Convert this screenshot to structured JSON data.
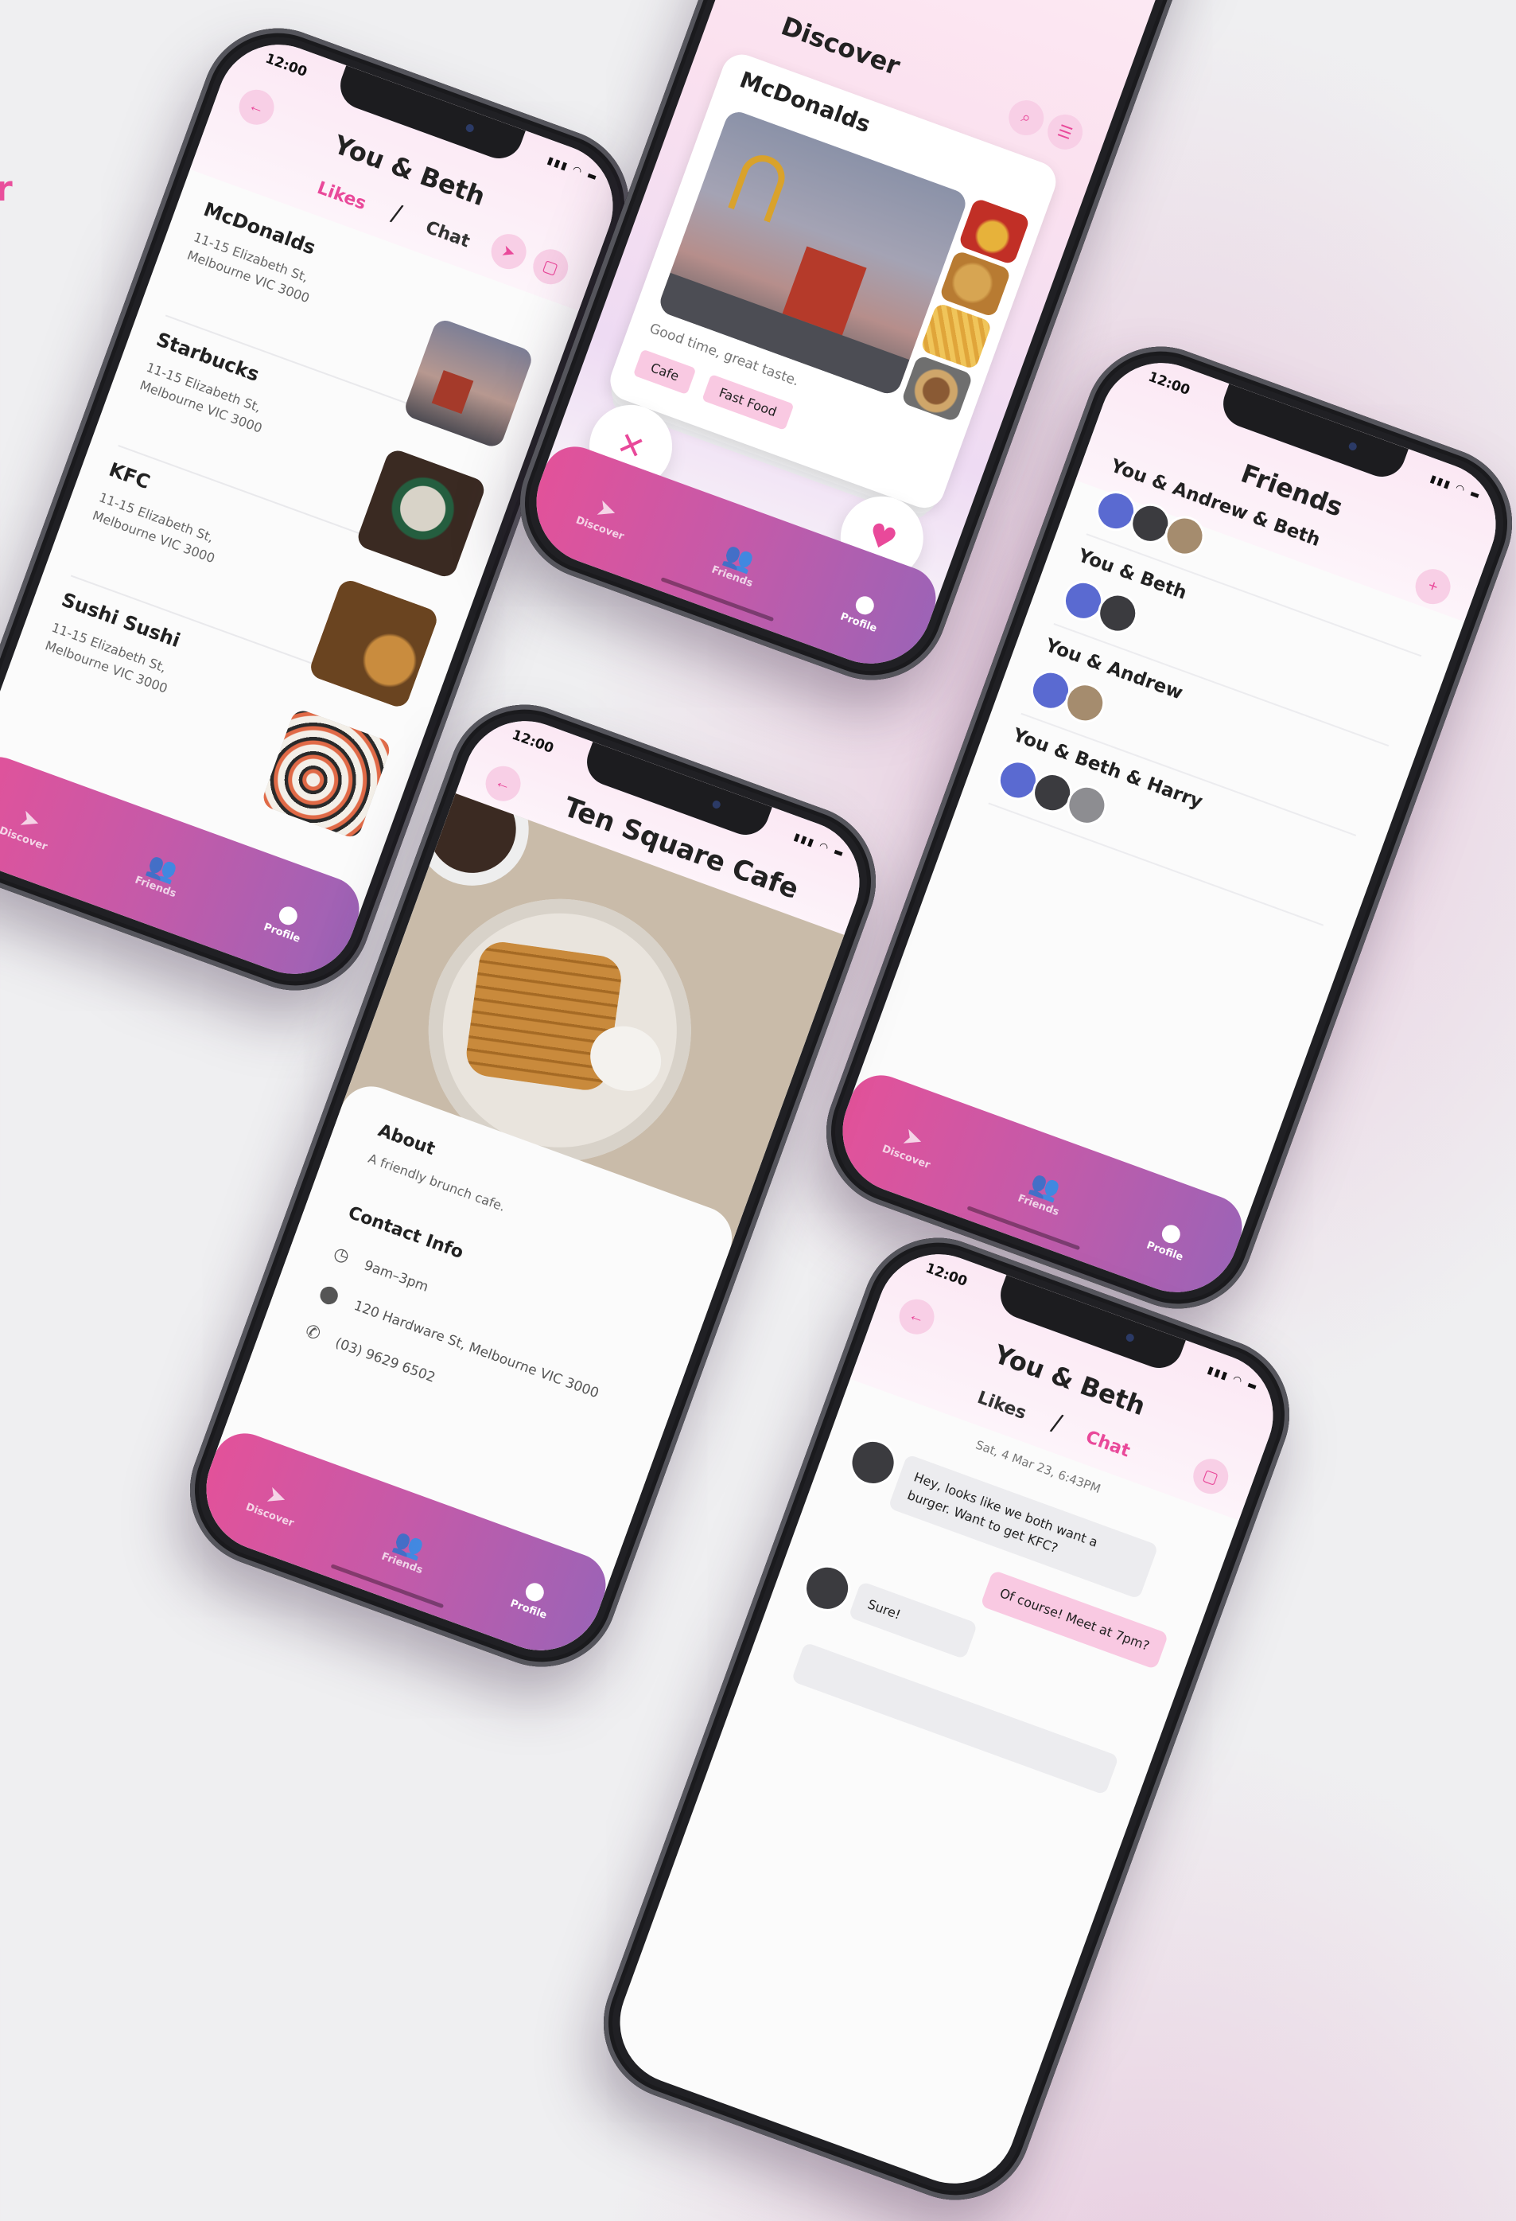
{
  "accent_color": "#e9499a",
  "corner_mark": "r",
  "status_time": "12:00",
  "tabbar": {
    "discover": "Discover",
    "friends": "Friends",
    "profile": "Profile"
  },
  "likes_screen": {
    "title": "You & Beth",
    "tab_likes": "Likes",
    "tab_chat": "Chat",
    "places": [
      {
        "name": "McDonalds",
        "address_line1": "11-15 Elizabeth St,",
        "address_line2": "Melbourne VIC 3000"
      },
      {
        "name": "Starbucks",
        "address_line1": "11-15 Elizabeth St,",
        "address_line2": "Melbourne VIC 3000"
      },
      {
        "name": "KFC",
        "address_line1": "11-15 Elizabeth St,",
        "address_line2": "Melbourne VIC 3000"
      },
      {
        "name": "Sushi Sushi",
        "address_line1": "11-15 Elizabeth St,",
        "address_line2": "Melbourne VIC 3000"
      }
    ]
  },
  "discover_screen": {
    "title": "Discover",
    "card_name": "McDonalds",
    "card_description": "Good time, great taste.",
    "tags": [
      "Cafe",
      "Fast Food"
    ],
    "reject_symbol": "✕",
    "like_symbol": "♥"
  },
  "friends_screen": {
    "title": "Friends",
    "groups": [
      {
        "name": "You & Andrew & Beth",
        "avatar_colors": [
          "#5a6ad1",
          "#3b3b3f",
          "#a58c6e"
        ]
      },
      {
        "name": "You & Beth",
        "avatar_colors": [
          "#5a6ad1",
          "#3b3b3f"
        ]
      },
      {
        "name": "You & Andrew",
        "avatar_colors": [
          "#5a6ad1",
          "#a58c6e"
        ]
      },
      {
        "name": "You & Beth & Harry",
        "avatar_colors": [
          "#5a6ad1",
          "#3b3b3f",
          "#8d8d91"
        ]
      }
    ]
  },
  "cafe_screen": {
    "title": "Ten Square Cafe",
    "about_heading": "About",
    "about_text": "A friendly brunch cafe.",
    "contact_heading": "Contact Info",
    "hours": "9am–3pm",
    "address": "120 Hardware St, Melbourne VIC 3000",
    "phone": "(03) 9629 6502"
  },
  "chat_screen": {
    "title": "You & Beth",
    "tab_likes": "Likes",
    "tab_chat": "Chat",
    "date": "Sat, 4 Mar 23, 6:43PM",
    "messages": [
      {
        "from": "Beth",
        "text": "Hey, looks like we both want a burger. Want to get KFC?"
      },
      {
        "from": "You",
        "text": "Of course! Meet at 7pm?"
      },
      {
        "from": "Beth",
        "text": "Sure!"
      }
    ]
  }
}
